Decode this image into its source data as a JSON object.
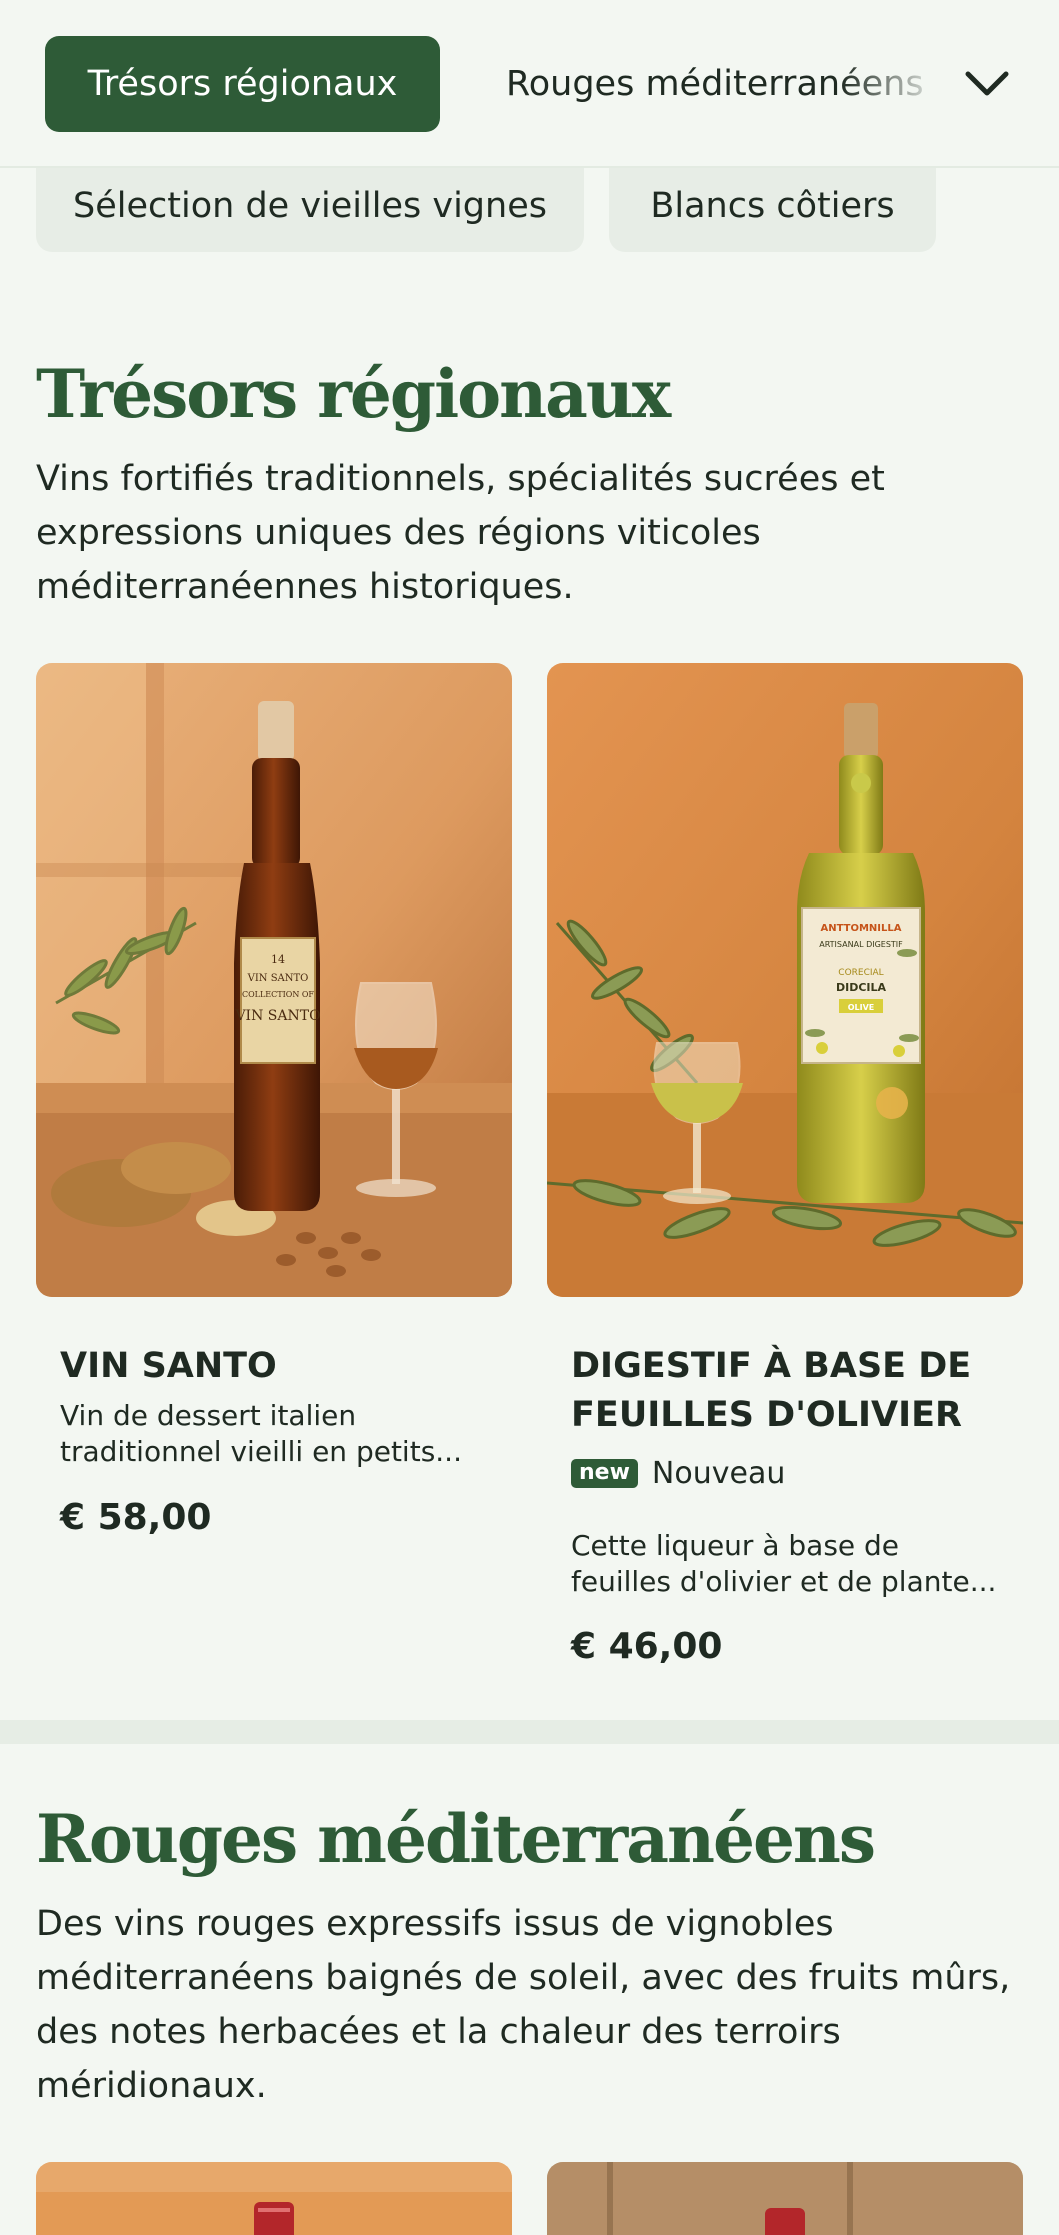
{
  "category_nav": {
    "active": "Trésors régionaux",
    "next": "Rouges méditerranéens",
    "secondary": [
      "Sélection de vieilles vignes",
      "Blancs côtiers"
    ],
    "expand_icon": "chevron-down-icon"
  },
  "sections": [
    {
      "title": "Trésors régionaux",
      "description": "Vins fortifiés traditionnels, spécialités sucrées et expressions uniques des régions viticoles méditerranéennes historiques.",
      "products": [
        {
          "name": "VIN SANTO",
          "description": "Vin de dessert italien traditionnel vieilli en petits...",
          "price": "€ 58,00",
          "label_lines": [
            "14",
            "VIN SANTO",
            "COLLECTION OF",
            "VIN SANTO"
          ]
        },
        {
          "name": "DIGESTIF À BASE DE FEUILLES D'OLIVIER",
          "badge": "new",
          "badge_label": "Nouveau",
          "description": "Cette liqueur à base de feuilles d'olivier et de plante...",
          "price": "€ 46,00",
          "label_lines": [
            "ANTTOMNILLA",
            "ARTISANAL DIGESTIF",
            "CORECIAL",
            "DIDCILA",
            "OLIVE"
          ]
        }
      ]
    },
    {
      "title": "Rouges méditerranéens",
      "description": "Des vins rouges expressifs issus de vignobles méditerranéens baignés de soleil, avec des fruits mûrs, des notes herbacées et la chaleur des terroirs méridionaux."
    }
  ],
  "colors": {
    "brand_green": "#2e5b37",
    "background": "#f3f7f2",
    "text": "#1f2a22"
  }
}
